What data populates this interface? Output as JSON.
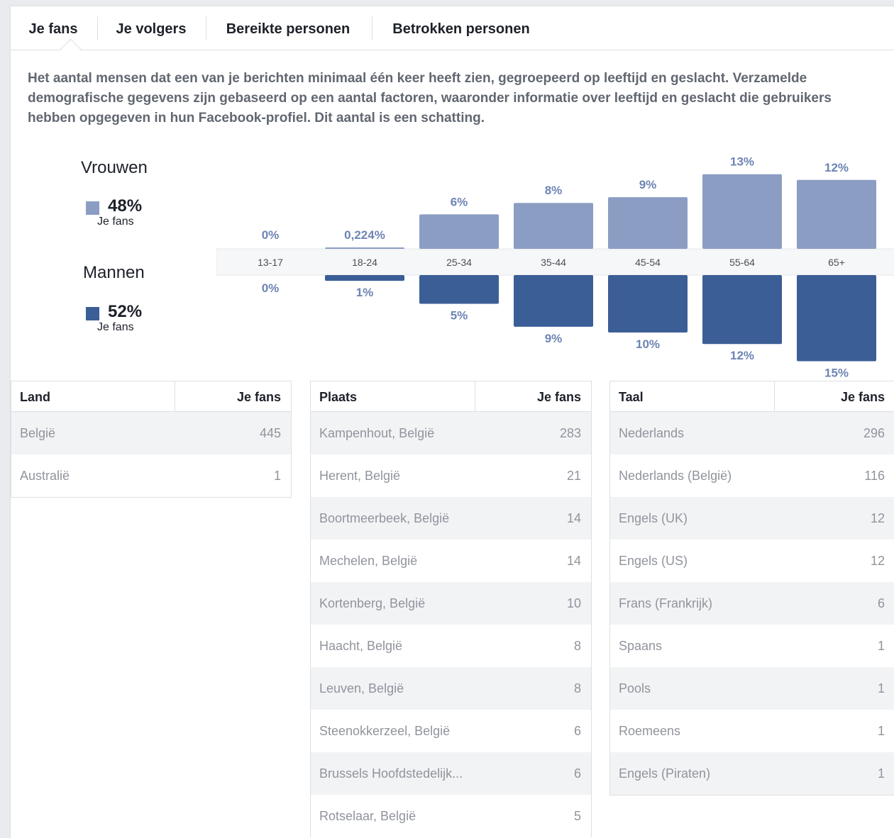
{
  "tabs": [
    {
      "label": "Je fans",
      "active": true
    },
    {
      "label": "Je volgers",
      "active": false
    },
    {
      "label": "Bereikte personen",
      "active": false
    },
    {
      "label": "Betrokken personen",
      "active": false
    }
  ],
  "description": "Het aantal mensen dat een van je berichten minimaal één keer heeft zien, gegroepeerd op leeftijd en geslacht. Verzamelde demografische gegevens zijn gebaseerd op een aantal factoren, waaronder informatie over leeftijd en geslacht die gebruikers hebben opgegeven in hun Facebook-profiel. Dit aantal is een schatting.",
  "legend": {
    "women": {
      "title": "Vrouwen",
      "pct": "48%",
      "sub": "Je fans",
      "color": "#8b9dc3"
    },
    "men": {
      "title": "Mannen",
      "pct": "52%",
      "sub": "Je fans",
      "color": "#3b5e96"
    }
  },
  "chart_data": {
    "type": "bar",
    "categories": [
      "13-17",
      "18-24",
      "25-34",
      "35-44",
      "45-54",
      "55-64",
      "65+"
    ],
    "series": [
      {
        "name": "Vrouwen",
        "values": [
          0,
          0.224,
          6,
          8,
          9,
          13,
          12
        ],
        "labels": [
          "0%",
          "0,224%",
          "6%",
          "8%",
          "9%",
          "13%",
          "12%"
        ]
      },
      {
        "name": "Mannen",
        "values": [
          0,
          1,
          5,
          9,
          10,
          12,
          15
        ],
        "labels": [
          "0%",
          "1%",
          "5%",
          "9%",
          "10%",
          "12%",
          "15%"
        ]
      }
    ]
  },
  "tables": {
    "land": {
      "col1": "Land",
      "col2": "Je fans",
      "rows": [
        {
          "name": "België",
          "value": "445"
        },
        {
          "name": "Australië",
          "value": "1"
        }
      ]
    },
    "plaats": {
      "col1": "Plaats",
      "col2": "Je fans",
      "rows": [
        {
          "name": "Kampenhout, België",
          "value": "283"
        },
        {
          "name": "Herent, België",
          "value": "21"
        },
        {
          "name": "Boortmeerbeek, België",
          "value": "14"
        },
        {
          "name": "Mechelen, België",
          "value": "14"
        },
        {
          "name": "Kortenberg, België",
          "value": "10"
        },
        {
          "name": "Haacht, België",
          "value": "8"
        },
        {
          "name": "Leuven, België",
          "value": "8"
        },
        {
          "name": "Steenokkerzeel, België",
          "value": "6"
        },
        {
          "name": "Brussels Hoofdstedelijk...",
          "value": "6"
        },
        {
          "name": "Rotselaar, België",
          "value": "5"
        }
      ]
    },
    "taal": {
      "col1": "Taal",
      "col2": "Je fans",
      "rows": [
        {
          "name": "Nederlands",
          "value": "296"
        },
        {
          "name": "Nederlands (België)",
          "value": "116"
        },
        {
          "name": "Engels (UK)",
          "value": "12"
        },
        {
          "name": "Engels (US)",
          "value": "12"
        },
        {
          "name": "Frans (Frankrijk)",
          "value": "6"
        },
        {
          "name": "Spaans",
          "value": "1"
        },
        {
          "name": "Pools",
          "value": "1"
        },
        {
          "name": "Roemeens",
          "value": "1"
        },
        {
          "name": "Engels (Piraten)",
          "value": "1"
        }
      ]
    }
  }
}
